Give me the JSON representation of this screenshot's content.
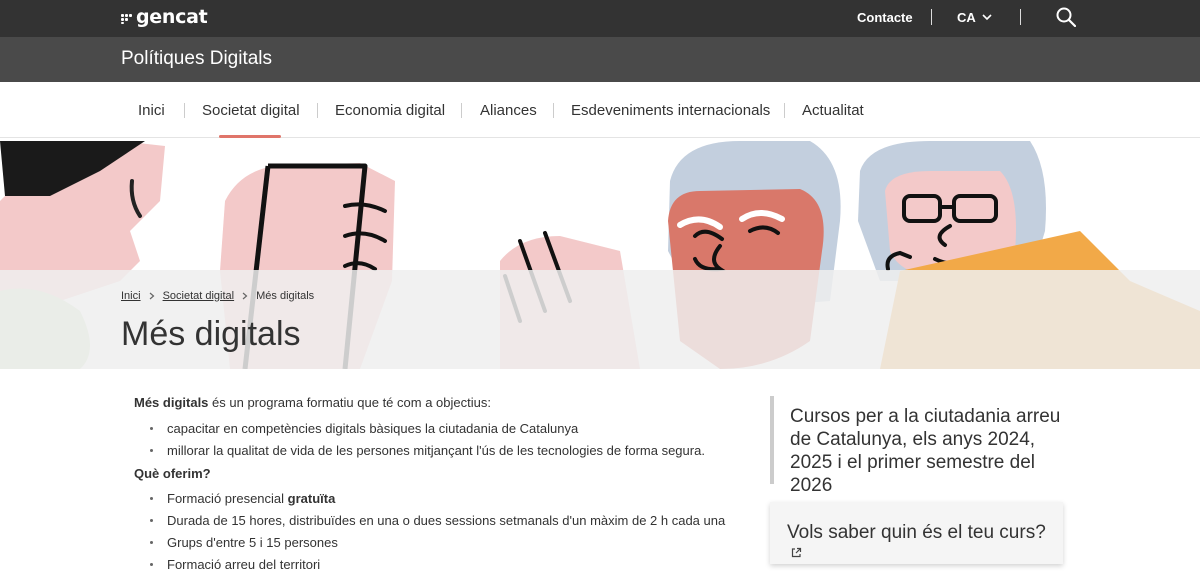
{
  "topbar": {
    "logo_text": "gencat",
    "contact_label": "Contacte",
    "lang_label": "CA"
  },
  "site": {
    "title": "Polítiques Digitals"
  },
  "nav": {
    "items": [
      {
        "label": "Inici"
      },
      {
        "label": "Societat digital"
      },
      {
        "label": "Economia digital"
      },
      {
        "label": "Aliances"
      },
      {
        "label": "Esdeveniments internacionals"
      },
      {
        "label": "Actualitat"
      }
    ],
    "active_index": 1
  },
  "breadcrumb": {
    "items": [
      {
        "label": "Inici"
      },
      {
        "label": "Societat digital"
      },
      {
        "label": "Més digitals"
      }
    ]
  },
  "page": {
    "title": "Més digitals"
  },
  "content": {
    "intro_bold": "Més digitals",
    "intro_rest": " és un programa formatiu que té com a objectius:",
    "objectives": [
      "capacitar en competències digitals bàsiques la ciutadania de Catalunya",
      "millorar la qualitat de vida de les persones mitjançant l'ús de les tecnologies de forma segura."
    ],
    "offer_heading": "Què oferim?",
    "offer_first_prefix": "Formació presencial ",
    "offer_first_bold": "gratuïta",
    "offer_items": [
      "Durada de 15 hores, distribuïdes en una o dues sessions setmanals d'un màxim de 2 h cada una",
      "Grups d'entre 5 i 15 persones",
      "Formació arreu del territori"
    ]
  },
  "aside": {
    "quote": "Cursos per a la ciutadania arreu de Catalunya, els anys 2024, 2025 i el primer semestre del 2026",
    "card_label": "Vols saber quin és el teu curs?"
  },
  "colors": {
    "topbar": "#333333",
    "subheader": "#4a4a4a",
    "accent": "#e0756a"
  },
  "icons": [
    "gencat-logo-icon",
    "chevron-down-icon",
    "search-icon",
    "chevron-right-icon",
    "external-link-icon"
  ]
}
